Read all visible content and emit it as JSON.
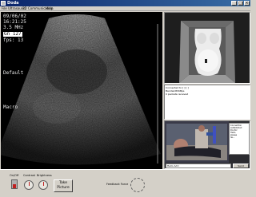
{
  "window": {
    "title": "Doda"
  },
  "menu": [
    "File",
    "Ultrasound",
    "3D",
    "Communication",
    "Help"
  ],
  "ultrasound": {
    "date": "09/06/02",
    "time": "16:21:25",
    "frequency": "3.5 MHz",
    "gain": "Gn 127",
    "fps": "fps: 13",
    "preset": "Default",
    "mode": "Macro"
  },
  "status": {
    "lines": [
      "Connected to [  ] [  ]",
      "BandwidthKBps",
      "0 packets received"
    ]
  },
  "chat": {
    "lines": [
      "Connection",
      "established",
      "Doctor:",
      "Hello,",
      "please",
      "lie..."
    ],
    "message": "Hello Adri",
    "send_label": "Send"
  },
  "controls": {
    "onoff_label": "On/Off",
    "contrast_label": "Contrast",
    "brightness_label": "Brightness",
    "take_picture_label": "Take\nPicture",
    "feedback_force_label": "Feedback Force"
  },
  "colors": {
    "titlebar": "#0a246a",
    "window_bg": "#d4d0c8",
    "dial_tick": "#c02020"
  }
}
